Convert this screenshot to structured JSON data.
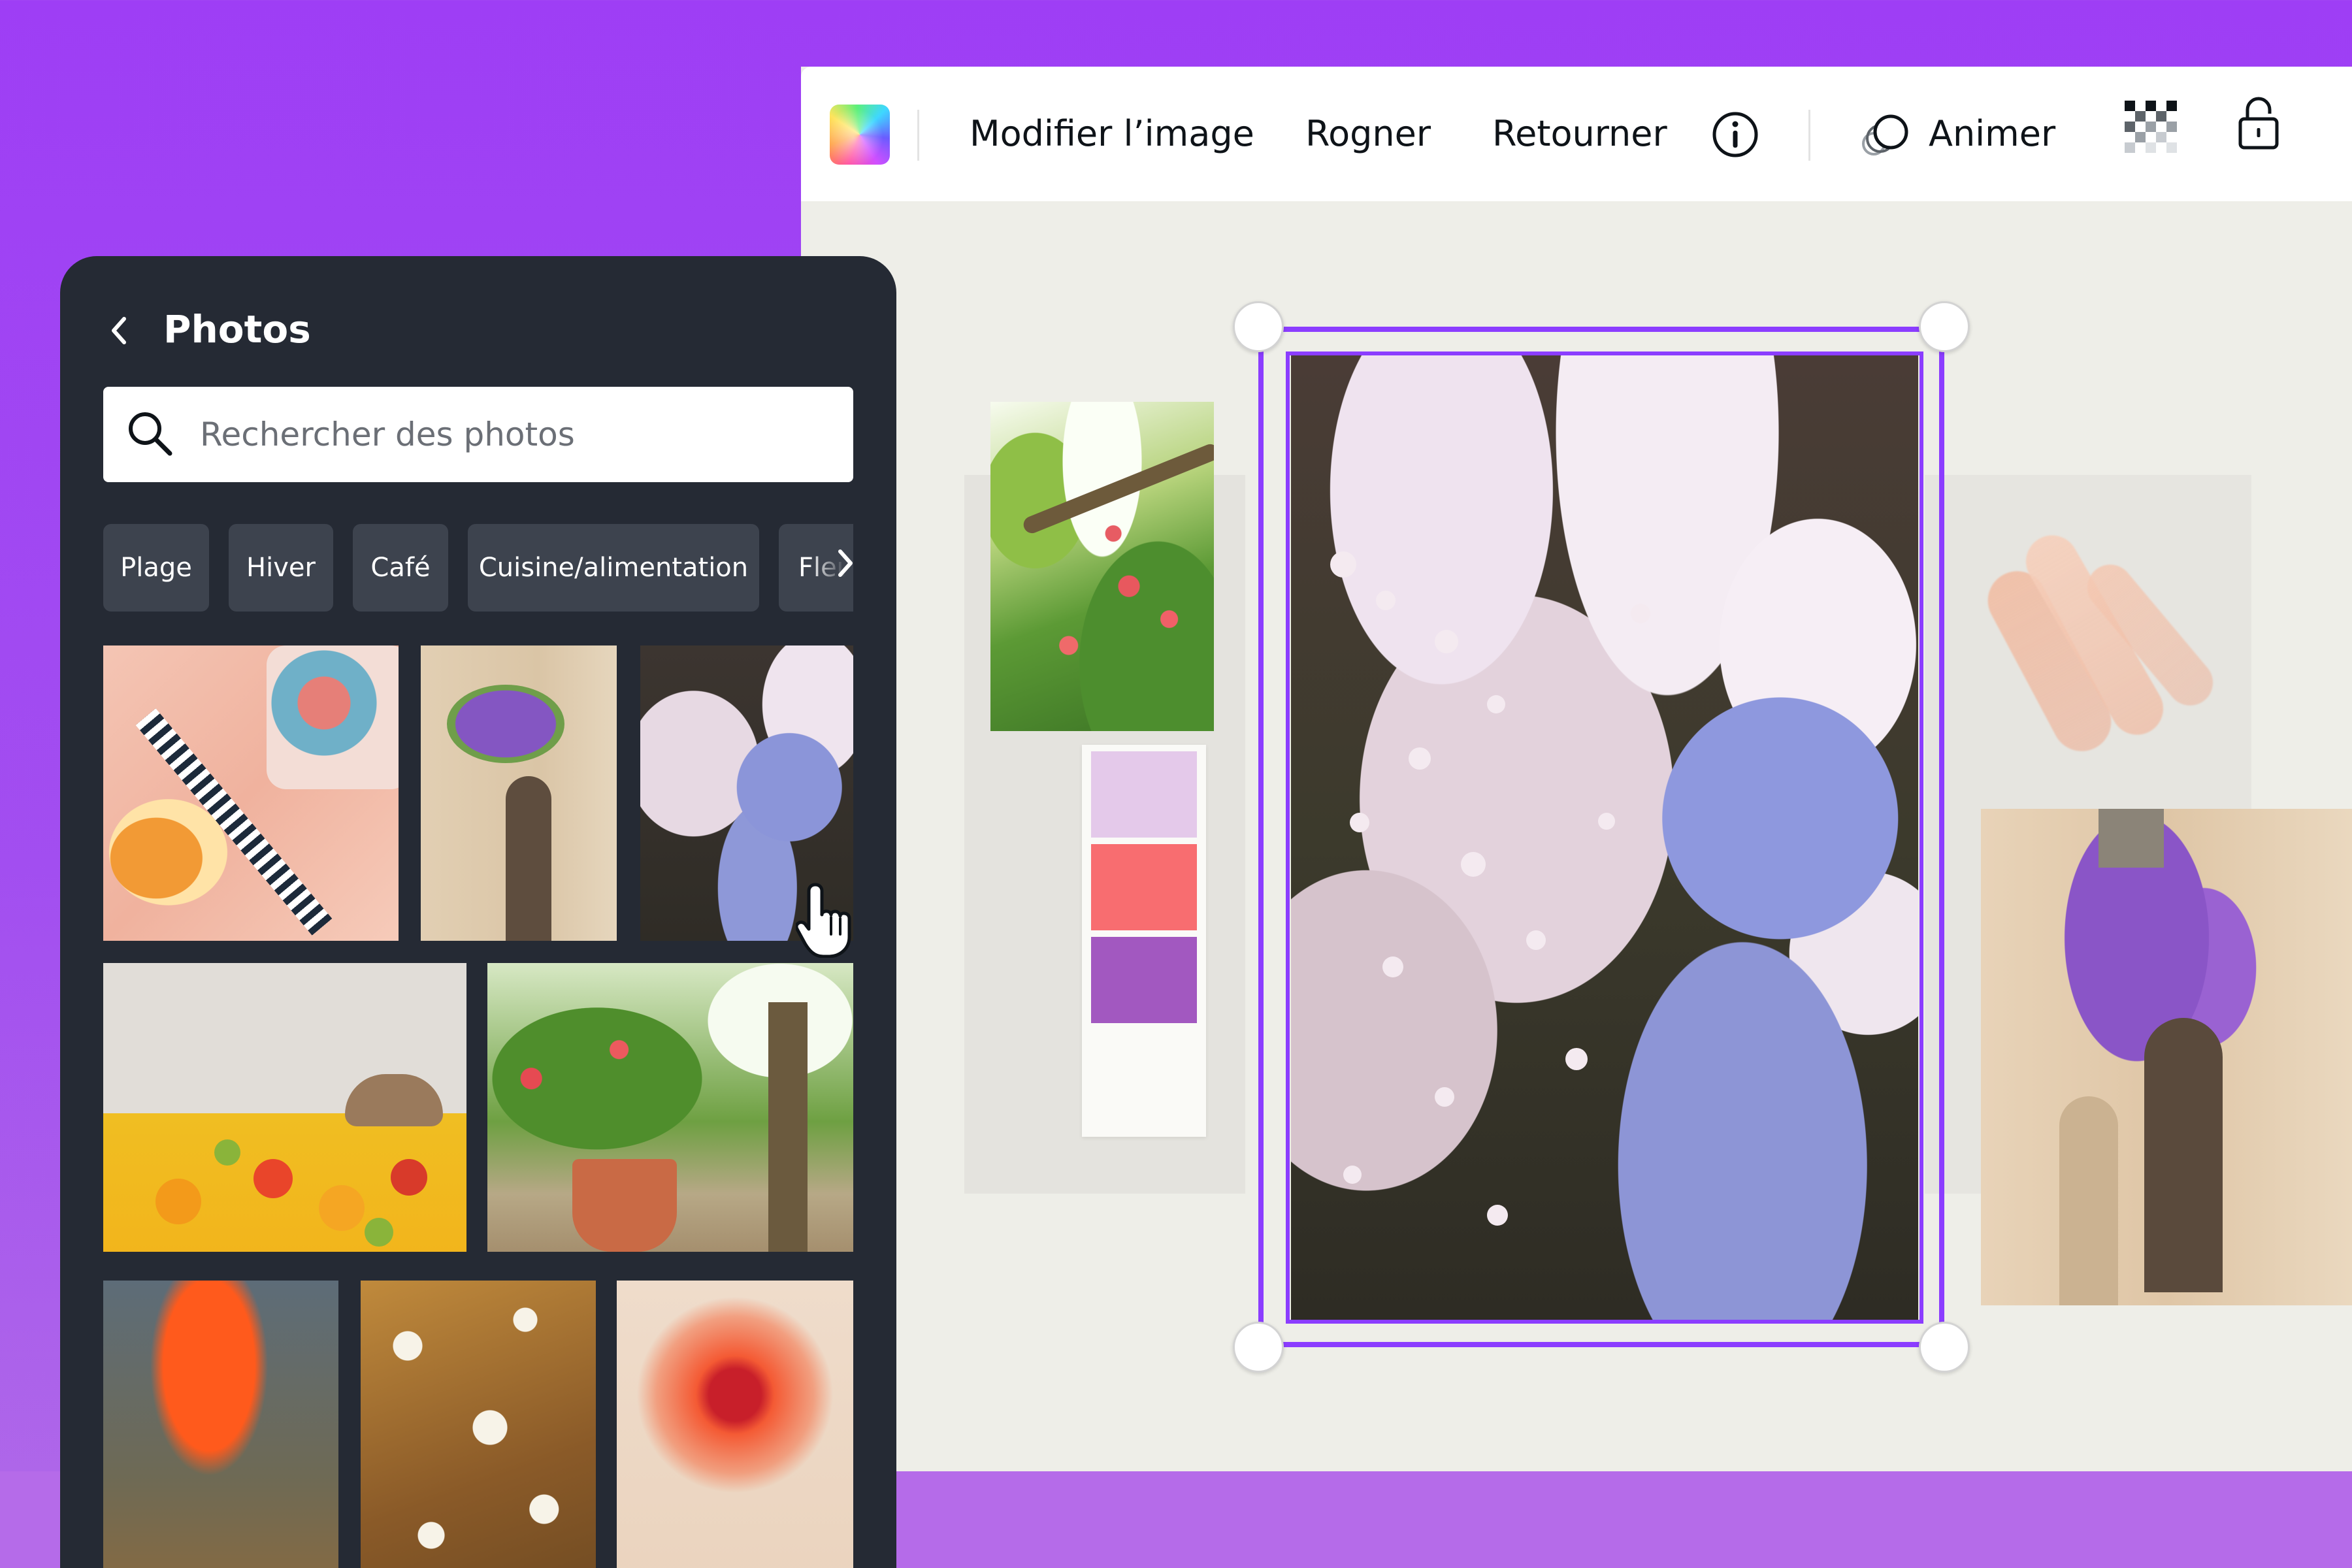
{
  "toolbar": {
    "items": [
      {
        "label": "Modifier l’image"
      },
      {
        "label": "Rogner"
      },
      {
        "label": "Retourner"
      },
      {
        "label": "Animer"
      }
    ]
  },
  "photos_panel": {
    "title": "Photos",
    "search": {
      "placeholder": "Rechercher des photos",
      "value": ""
    },
    "categories": [
      {
        "label": "Plage"
      },
      {
        "label": "Hiver"
      },
      {
        "label": "Café"
      },
      {
        "label": "Cuisine/alimentation"
      },
      {
        "label": "Fleu"
      }
    ]
  },
  "palette": {
    "colors": [
      "#e4c9ea",
      "#f86d70",
      "#a258c0"
    ]
  },
  "colors": {
    "background": "#9e3ef5",
    "selection": "#8b3dff",
    "panel": "#252a34",
    "chip": "#3d434e"
  },
  "icons": {
    "back": "chevron-left-icon",
    "search": "search-icon",
    "info": "info-icon",
    "animate": "animate-icon",
    "transparency": "transparency-icon",
    "lock": "lock-icon",
    "more": "chevron-right-icon",
    "cursor": "hand-pointer-icon"
  }
}
